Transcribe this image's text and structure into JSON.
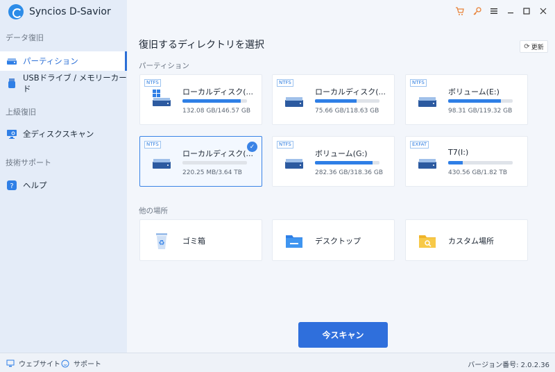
{
  "app": {
    "title": "Syncios D-Savior"
  },
  "sidebar": {
    "sections": [
      {
        "label": "データ復旧"
      },
      {
        "label": "上級復旧"
      },
      {
        "label": "技術サポート"
      }
    ],
    "items": [
      {
        "label": "パーティション",
        "icon": "drive-icon",
        "active": true
      },
      {
        "label": "USBドライブ / メモリーカード",
        "icon": "usb-icon"
      },
      {
        "label": "全ディスクスキャン",
        "icon": "monitor-icon"
      },
      {
        "label": "ヘルプ",
        "icon": "help-icon"
      }
    ]
  },
  "main": {
    "title": "復旧するディレクトリを選択",
    "refresh_label": "更新",
    "partition_label": "パーティション",
    "other_label": "他の場所",
    "partitions": [
      {
        "fs": "NTFS",
        "name": "ローカルディスク(...",
        "size": "132.08 GB/146.57 GB",
        "used": 0.9,
        "icon": "windows-drive-icon"
      },
      {
        "fs": "NTFS",
        "name": "ローカルディスク(...",
        "size": "75.66 GB/118.63 GB",
        "used": 0.64,
        "icon": "drive-icon"
      },
      {
        "fs": "NTFS",
        "name": "ボリューム(E:)",
        "size": "98.31 GB/119.32 GB",
        "used": 0.82,
        "icon": "drive-icon"
      },
      {
        "fs": "NTFS",
        "name": "ローカルディスク(...",
        "size": "220.25 MB/3.64 TB",
        "used": 0.0,
        "icon": "drive-icon",
        "selected": true
      },
      {
        "fs": "NTFS",
        "name": "ボリューム(G:)",
        "size": "282.36 GB/318.36 GB",
        "used": 0.89,
        "icon": "drive-icon"
      },
      {
        "fs": "EXFAT",
        "name": "T7(I:)",
        "size": "430.56 GB/1.82 TB",
        "used": 0.23,
        "icon": "drive-icon"
      }
    ],
    "locations": [
      {
        "label": "ゴミ箱",
        "icon": "recycle-bin-icon"
      },
      {
        "label": "デスクトップ",
        "icon": "desktop-folder-icon"
      },
      {
        "label": "カスタム場所",
        "icon": "custom-folder-icon"
      }
    ],
    "scan_button": "今スキャン"
  },
  "footer": {
    "website": "ウェブサイト",
    "support": "サポート",
    "version": "バージョン番号: 2.0.2.36"
  },
  "colors": {
    "accent": "#2f6fdc",
    "cart": "#e8833a",
    "key": "#e8833a"
  }
}
